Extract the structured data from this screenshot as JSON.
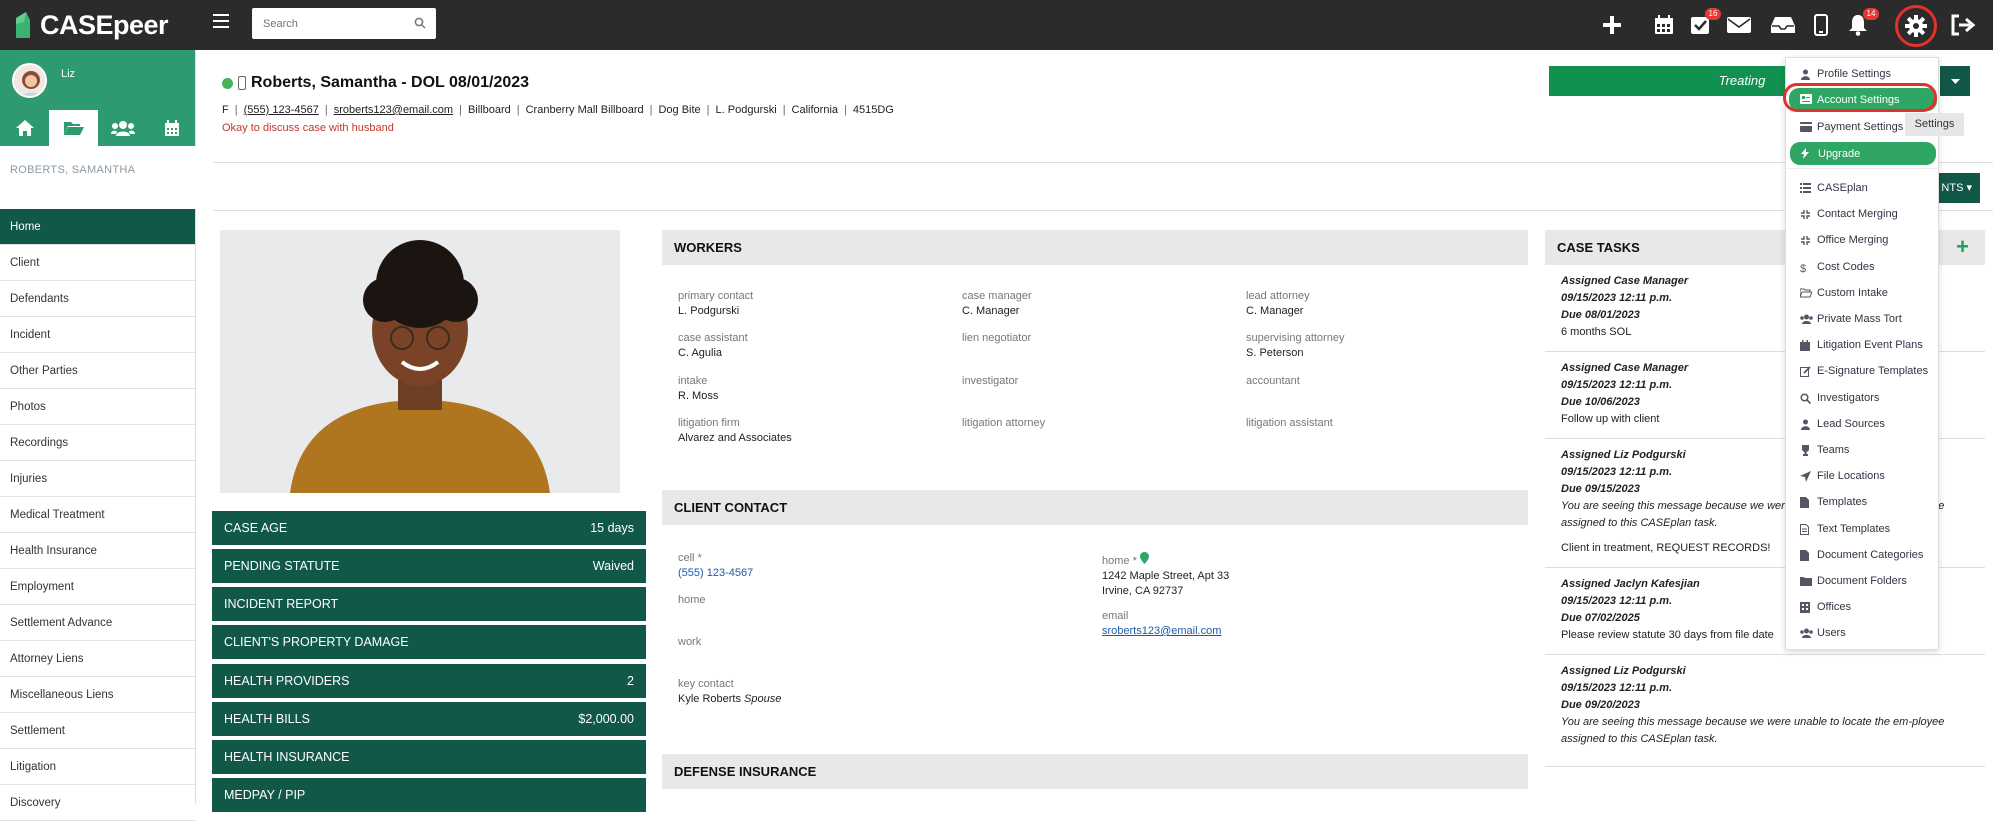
{
  "app": {
    "brand": "CASEpeer",
    "search_placeholder": "Search",
    "colors": {
      "brand_green": "#2e9a6f",
      "dark_green": "#115848",
      "treating_green": "#11914f",
      "highlight_red": "#e4312b"
    }
  },
  "topbar": {
    "icons": [
      "plus-icon",
      "calendar-icon",
      "tasks-icon",
      "mail-icon",
      "inbox-icon",
      "mobile-icon",
      "bell-icon",
      "gear-icon",
      "logout-icon"
    ],
    "tasks_badge": "16",
    "bell_badge": "14"
  },
  "sidebar": {
    "user": "Liz",
    "client_name": "ROBERTS, SAMANTHA",
    "tabs": [
      "home-icon",
      "folder-icon",
      "users-icon",
      "calendar-icon"
    ],
    "items": [
      "Home",
      "Client",
      "Defendants",
      "Incident",
      "Other Parties",
      "Photos",
      "Recordings",
      "Injuries",
      "Medical Treatment",
      "Health Insurance",
      "Employment",
      "Settlement Advance",
      "Attorney Liens",
      "Miscellaneous Liens",
      "Settlement",
      "Litigation",
      "Discovery"
    ]
  },
  "case": {
    "title": "Roberts, Samantha - DOL 08/01/2023",
    "gender": "F",
    "phone": "(555) 123-4567",
    "email": "sroberts123@email.com",
    "meta": [
      "Billboard",
      "Cranberry Mall Billboard",
      "Dog Bite",
      "L. Podgurski",
      "California",
      "4515DG"
    ],
    "note": "Okay to discuss case with husband",
    "status": "Treating",
    "docs_button": "NTS"
  },
  "stats": [
    {
      "label": "CASE AGE",
      "value": "15 days"
    },
    {
      "label": "PENDING STATUTE",
      "value": "Waived"
    },
    {
      "label": "INCIDENT REPORT",
      "value": ""
    },
    {
      "label": "CLIENT'S PROPERTY DAMAGE",
      "value": ""
    },
    {
      "label": "HEALTH PROVIDERS",
      "value": "2"
    },
    {
      "label": "HEALTH BILLS",
      "value": "$2,000.00"
    },
    {
      "label": "HEALTH INSURANCE",
      "value": ""
    },
    {
      "label": "MEDPAY / PIP",
      "value": ""
    }
  ],
  "workers": {
    "title": "WORKERS",
    "fields": [
      {
        "label": "primary contact",
        "value": "L. Podgurski"
      },
      {
        "label": "case manager",
        "value": "C. Manager"
      },
      {
        "label": "lead attorney",
        "value": "C. Manager"
      },
      {
        "label": "case assistant",
        "value": "C. Agulia"
      },
      {
        "label": "lien negotiator",
        "value": ""
      },
      {
        "label": "supervising attorney",
        "value": "S. Peterson"
      },
      {
        "label": "intake",
        "value": "R. Moss"
      },
      {
        "label": "investigator",
        "value": ""
      },
      {
        "label": "accountant",
        "value": ""
      },
      {
        "label": "litigation firm",
        "value": "Alvarez and Associates"
      },
      {
        "label": "litigation attorney",
        "value": ""
      },
      {
        "label": "litigation assistant",
        "value": ""
      }
    ]
  },
  "client_contact": {
    "title": "CLIENT CONTACT",
    "cell_label": "cell *",
    "cell_value": "(555) 123-4567",
    "home_label_left": "home",
    "work_label": "work",
    "key_contact_label": "key contact",
    "key_contact_name": "Kyle Roberts",
    "key_contact_rel": "Spouse",
    "home_label": "home *",
    "address1": "1242 Maple Street, Apt 33",
    "address2": "Irvine, CA 92737",
    "email_label": "email",
    "email_value": "sroberts123@email.com"
  },
  "defense": {
    "title": "DEFENSE INSURANCE"
  },
  "case_tasks": {
    "title": "CASE TASKS",
    "items": [
      {
        "assigned": "Assigned Case Manager",
        "date": "09/15/2023 12:11 p.m.",
        "due": "Due 08/01/2023",
        "msg": "",
        "text": "6 months SOL"
      },
      {
        "assigned": "Assigned Case Manager",
        "date": "09/15/2023 12:11 p.m.",
        "due": "Due 10/06/2023",
        "msg": "",
        "text": "Follow up with client"
      },
      {
        "assigned": "Assigned Liz Podgurski",
        "date": "09/15/2023 12:11 p.m.",
        "due": "Due 09/15/2023",
        "msg": "You are seeing this message because we were unable to locate the em-ployee assigned to this CASEplan task.",
        "text": "Client in treatment, REQUEST RECORDS!"
      },
      {
        "assigned": "Assigned Jaclyn Kafesjian",
        "date": "09/15/2023 12:11 p.m.",
        "due": "Due 07/02/2025",
        "msg": "",
        "text": "Please review statute 30 days from file date"
      },
      {
        "assigned": "Assigned Liz Podgurski",
        "date": "09/15/2023 12:11 p.m.",
        "due": "Due 09/20/2023",
        "msg": "You are seeing this message because we were unable to locate the em-ployee assigned to this CASEplan task.",
        "text": ""
      }
    ]
  },
  "settings_menu": {
    "tooltip": "Settings",
    "items": [
      {
        "label": "Profile Settings",
        "icon": "user-icon"
      },
      {
        "label": "Account Settings",
        "icon": "id-card-icon"
      },
      {
        "label": "Payment Settings",
        "icon": "credit-card-icon"
      },
      {
        "label": "Upgrade",
        "icon": "bolt-icon"
      },
      {
        "label": "CASEplan",
        "icon": "list-icon"
      },
      {
        "label": "Contact Merging",
        "icon": "merge-icon"
      },
      {
        "label": "Office Merging",
        "icon": "merge-icon"
      },
      {
        "label": "Cost Codes",
        "icon": "dollar-icon"
      },
      {
        "label": "Custom Intake",
        "icon": "folder-open-icon"
      },
      {
        "label": "Private Mass Tort",
        "icon": "users-icon"
      },
      {
        "label": "Litigation Event Plans",
        "icon": "calendar-icon"
      },
      {
        "label": "E-Signature Templates",
        "icon": "edit-icon"
      },
      {
        "label": "Investigators",
        "icon": "search-icon"
      },
      {
        "label": "Lead Sources",
        "icon": "user-icon"
      },
      {
        "label": "Teams",
        "icon": "trophy-icon"
      },
      {
        "label": "File Locations",
        "icon": "location-arrow-icon"
      },
      {
        "label": "Templates",
        "icon": "file-icon"
      },
      {
        "label": "Text Templates",
        "icon": "file-text-icon"
      },
      {
        "label": "Document Categories",
        "icon": "file-icon"
      },
      {
        "label": "Document Folders",
        "icon": "folder-icon"
      },
      {
        "label": "Offices",
        "icon": "building-icon"
      },
      {
        "label": "Users",
        "icon": "users-icon"
      }
    ]
  }
}
